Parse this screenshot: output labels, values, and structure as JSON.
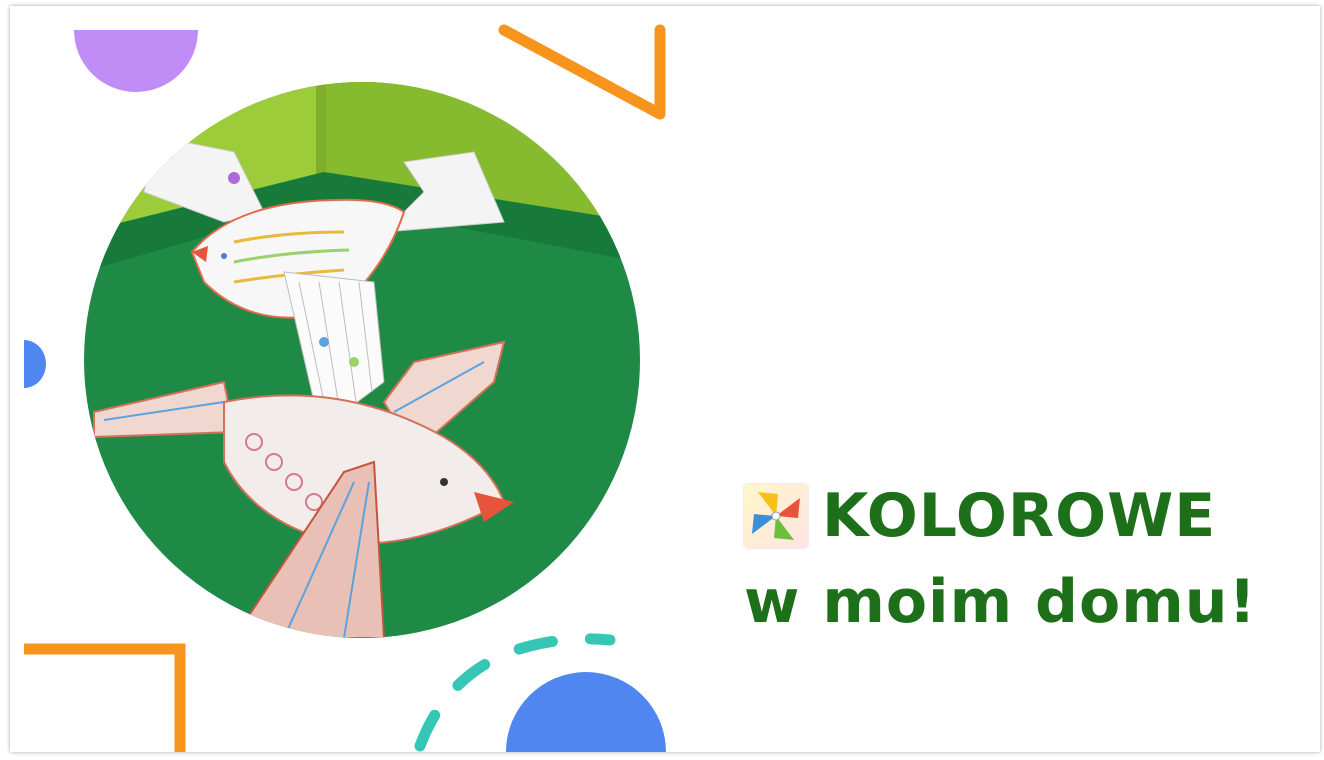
{
  "headline": {
    "line1": "KOLOROWE",
    "line2": "w moim domu!"
  },
  "icons": {
    "logo": "pinwheel-icon"
  },
  "colors": {
    "headline": "#1e6f1a",
    "orange": "#f7941d",
    "purple": "#c08cf5",
    "teal": "#35c6b5",
    "blue": "#4f86f0",
    "green_paper": "#1f8a45"
  }
}
